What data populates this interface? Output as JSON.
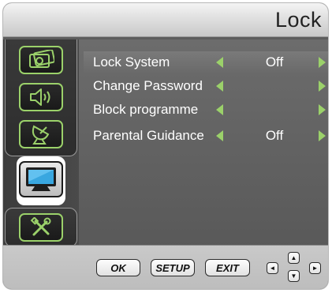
{
  "header": {
    "title": "Lock"
  },
  "sidebar": {
    "items": [
      {
        "icon": "picture-icon"
      },
      {
        "icon": "speaker-icon"
      },
      {
        "icon": "satellite-dish-icon"
      },
      {
        "icon": "monitor-icon",
        "selected": true
      },
      {
        "icon": "tools-icon"
      }
    ]
  },
  "menu": {
    "rows": [
      {
        "label": "Lock System",
        "value": "Off",
        "highlighted": true
      },
      {
        "label": "Change Password",
        "value": ""
      },
      {
        "label": "Block programme",
        "value": ""
      },
      {
        "label": "Parental Guidance",
        "value": "Off"
      }
    ]
  },
  "footer": {
    "ok": "OK",
    "setup": "SETUP",
    "exit": "EXIT",
    "dpad": {
      "up": "▲",
      "down": "▼",
      "left": "◄",
      "right": "►"
    }
  },
  "colors": {
    "accent": "#9bd16a",
    "panel": "#5d5d5d",
    "header": "#d9d9d9",
    "footer": "#c4c4c4"
  }
}
